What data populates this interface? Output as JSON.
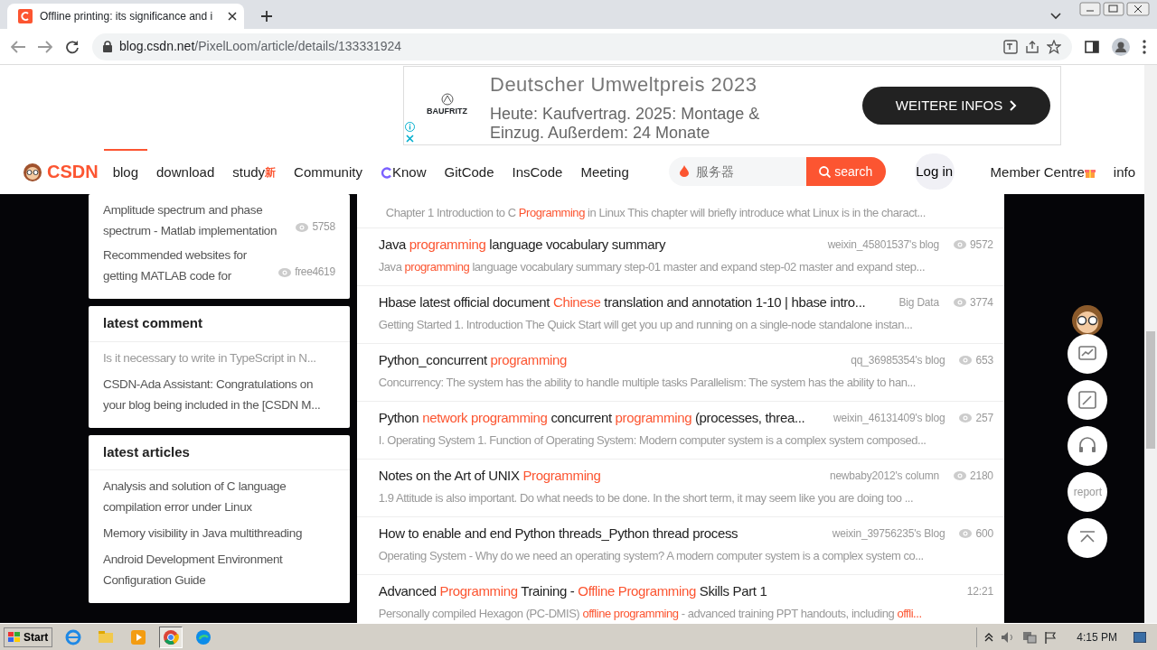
{
  "browser": {
    "tab_title": "Offline printing: its significance and i",
    "url_host": "blog.csdn.net",
    "url_path": "/PixelLoom/article/details/133331924"
  },
  "ad": {
    "brand": "BAUFRITZ",
    "headline": "Deutscher Umweltpreis 2023",
    "body": "Heute: Kaufvertrag. 2025: Montage & Einzug. Außerdem: 24 Monate",
    "button": "WEITERE INFOS"
  },
  "nav": {
    "logo": "CSDN",
    "items": [
      {
        "label": "blog",
        "selected": true
      },
      {
        "label": "download",
        "selected": false
      },
      {
        "label": "study",
        "selected": false,
        "badge": "新"
      },
      {
        "label": "Community",
        "selected": false
      },
      {
        "label": "Know",
        "selected": false,
        "kind": "know"
      },
      {
        "label": "GitCode",
        "selected": false
      },
      {
        "label": "InsCode",
        "selected": false
      },
      {
        "label": "Meeting",
        "selected": false
      }
    ],
    "search_placeholder": "服务器",
    "search_button": "search",
    "login": "Log in",
    "member": "Member Centre",
    "more": "info"
  },
  "sidebar": [
    {
      "items": [
        {
          "text": "Amplitude spectrum and phase spectrum - Matlab implementation",
          "views": "5758"
        },
        {
          "text": "Recommended websites for getting MATLAB code for",
          "views": "free4619"
        }
      ]
    },
    {
      "title": "latest comment",
      "items": [
        {
          "text": "Is it necessary to write in TypeScript in N...",
          "kind": "muted"
        },
        {
          "text": "CSDN-Ada Assistant: Congratulations on your blog being included in the [CSDN M...",
          "kind": "normal"
        }
      ]
    },
    {
      "title": "latest articles",
      "items": [
        {
          "text": "Analysis and solution of C language compilation error under Linux"
        },
        {
          "text": "Memory visibility in Java multithreading"
        },
        {
          "text": "Android Development Environment Configuration Guide"
        }
      ]
    }
  ],
  "articles": [
    {
      "description": "Chapter 1 Introduction to C *Programming* in Linux This chapter will briefly introduce what Linux is in the charact..."
    },
    {
      "title": "Java *programming* language vocabulary summary",
      "author": "weixin_45801537's blog",
      "views": "9572",
      "description": "Java *programming* language vocabulary summary step-01 master and expand step-02 master and expand step..."
    },
    {
      "title": "Hbase latest official document *Chinese* translation and annotation 1-10 | hbase intro...",
      "author": "Big Data",
      "views": "3774",
      "description": "Getting Started 1. Introduction The Quick Start will get you up and running on a single-node standalone instan..."
    },
    {
      "title": "Python_concurrent *programming*",
      "author": "qq_36985354's blog",
      "views": "653",
      "description": "Concurrency: The system has the ability to handle multiple tasks Parallelism: The system has the ability to han..."
    },
    {
      "title": "Python *network programming* concurrent *programming* (processes, threa...",
      "author": "weixin_46131409's blog",
      "views": "257",
      "description": "I. Operating System 1. Function of Operating System: Modern computer system is a complex system composed..."
    },
    {
      "title": "Notes on the Art of UNIX *Programming*",
      "author": "newbaby2012's column",
      "views": "2180",
      "description": "1.9 Attitude is also important. Do what needs to be done. In the short term, it may seem like you are doing too ..."
    },
    {
      "title": "How to enable and end Python threads_Python thread process",
      "author": "weixin_39756235's Blog",
      "views": "600",
      "description": "Operating System - Why do we need an operating system? A modern computer system is a complex system co..."
    },
    {
      "title": "Advanced *Programming* Training - *Offline Programming* Skills Part 1",
      "author": "12:21",
      "description": "Personally compiled Hexagon (PC-DMIS) *offline programming* - advanced training PPT handouts, including *offli...*"
    }
  ],
  "float_tools": [
    {
      "kind": "mascot"
    },
    {
      "kind": "chart"
    },
    {
      "kind": "edit"
    },
    {
      "kind": "headset"
    },
    {
      "kind": "text",
      "label": "report"
    },
    {
      "kind": "top"
    }
  ],
  "taskbar": {
    "start": "Start",
    "apps": [
      {
        "kind": "ie",
        "selected": false
      },
      {
        "kind": "folder",
        "selected": false
      },
      {
        "kind": "media",
        "selected": false
      },
      {
        "kind": "chrome",
        "selected": true
      },
      {
        "kind": "edge",
        "selected": false
      }
    ],
    "time": "4:15 PM"
  }
}
